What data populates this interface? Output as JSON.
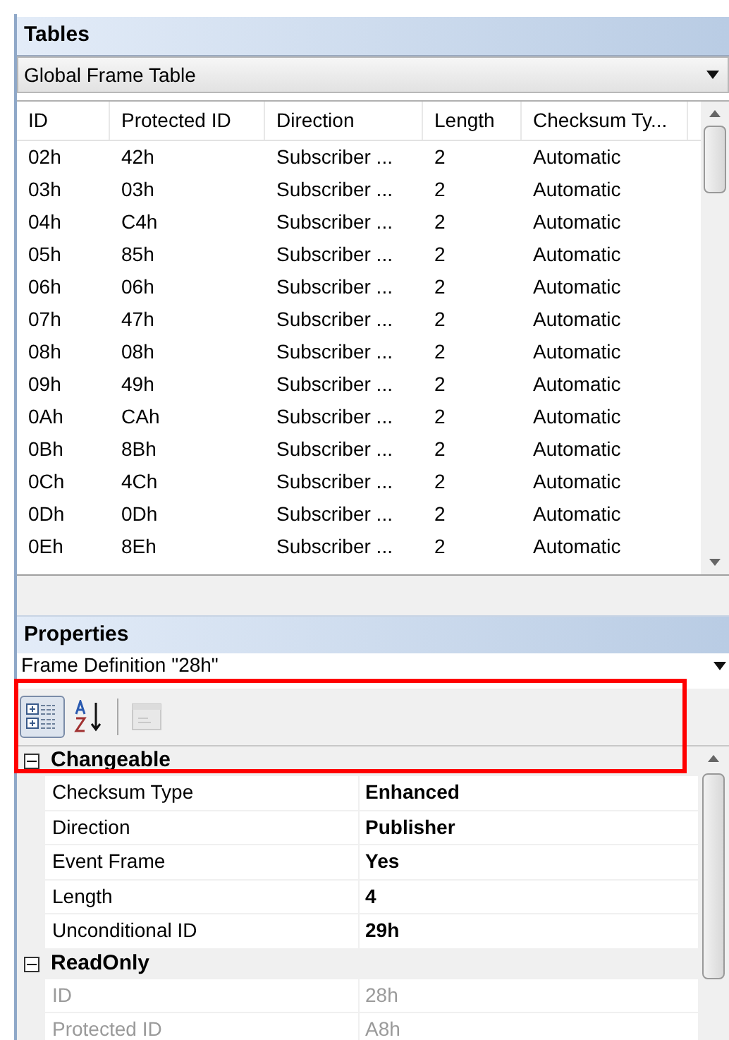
{
  "tables_panel": {
    "title": "Tables",
    "selector": {
      "value": "Global Frame Table"
    },
    "table": {
      "columns": [
        "ID",
        "Protected ID",
        "Direction",
        "Length",
        "Checksum Ty..."
      ],
      "rows": [
        [
          "02h",
          "42h",
          "Subscriber ...",
          "2",
          "Automatic"
        ],
        [
          "03h",
          "03h",
          "Subscriber ...",
          "2",
          "Automatic"
        ],
        [
          "04h",
          "C4h",
          "Subscriber ...",
          "2",
          "Automatic"
        ],
        [
          "05h",
          "85h",
          "Subscriber ...",
          "2",
          "Automatic"
        ],
        [
          "06h",
          "06h",
          "Subscriber ...",
          "2",
          "Automatic"
        ],
        [
          "07h",
          "47h",
          "Subscriber ...",
          "2",
          "Automatic"
        ],
        [
          "08h",
          "08h",
          "Subscriber ...",
          "2",
          "Automatic"
        ],
        [
          "09h",
          "49h",
          "Subscriber ...",
          "2",
          "Automatic"
        ],
        [
          "0Ah",
          "CAh",
          "Subscriber ...",
          "2",
          "Automatic"
        ],
        [
          "0Bh",
          "8Bh",
          "Subscriber ...",
          "2",
          "Automatic"
        ],
        [
          "0Ch",
          "4Ch",
          "Subscriber ...",
          "2",
          "Automatic"
        ],
        [
          "0Dh",
          "0Dh",
          "Subscriber ...",
          "2",
          "Automatic"
        ],
        [
          "0Eh",
          "8Eh",
          "Subscriber ...",
          "2",
          "Automatic"
        ]
      ]
    }
  },
  "properties_panel": {
    "title": "Properties",
    "selector": {
      "value": "Frame Definition \"28h\""
    },
    "toolbar": [
      {
        "kind": "categorized",
        "selected": true,
        "disabled": false
      },
      {
        "kind": "alphabetical",
        "selected": false,
        "disabled": false
      },
      {
        "kind": "pages",
        "selected": false,
        "disabled": true
      }
    ],
    "categories": [
      {
        "name": "Changeable",
        "expanded": true,
        "properties": [
          {
            "name": "Checksum Type",
            "value": "Enhanced",
            "readonly": false
          },
          {
            "name": "Direction",
            "value": "Publisher",
            "readonly": false
          },
          {
            "name": "Event Frame",
            "value": "Yes",
            "readonly": false
          },
          {
            "name": "Length",
            "value": "4",
            "readonly": false
          },
          {
            "name": "Unconditional ID",
            "value": "29h",
            "readonly": false
          }
        ]
      },
      {
        "name": "ReadOnly",
        "expanded": true,
        "properties": [
          {
            "name": "ID",
            "value": "28h",
            "readonly": true
          },
          {
            "name": "Protected ID",
            "value": "A8h",
            "readonly": true
          }
        ]
      }
    ]
  }
}
